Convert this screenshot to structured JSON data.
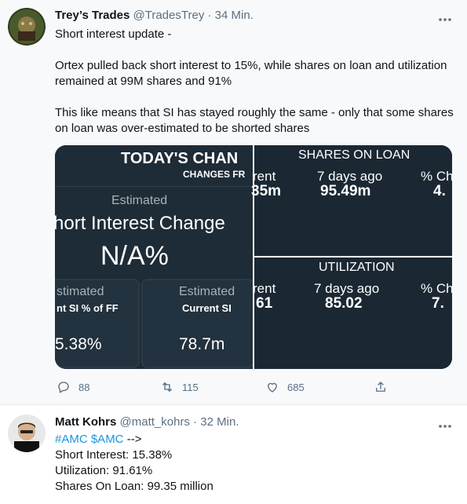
{
  "tweet1": {
    "author_name": "Trey’s Trades",
    "handle": "@TradesTrey",
    "separator": "·",
    "time": "34 Min.",
    "lines": [
      "Short interest update -",
      "",
      "Ortex pulled back short interest to 15%, while shares on loan and utilization remained at 99M shares and 91%",
      "",
      "This like means that SI has stayed roughly the same - only that some shares on loan was over-estimated to be shorted shares"
    ],
    "media": {
      "left": {
        "title": "TODAY'S CHAN",
        "subtitle": "CHANGES FR",
        "estimated_label": "Estimated",
        "metric_label": "hort Interest Change",
        "metric_value": "N/A%",
        "card1_estimated": "stimated",
        "card1_label": "nt SI % of FF",
        "card1_value": "5.38%",
        "card2_estimated": "Estimated",
        "card2_label": "Current SI",
        "card2_value": "78.7m"
      },
      "top_right": {
        "title": "SHARES ON LOAN",
        "col1_label": "rent",
        "col1_value": "35m",
        "col2_label": "7 days ago",
        "col2_value": "95.49m",
        "col3_label": "% Ch",
        "col3_value": "4."
      },
      "bottom_right": {
        "title": "UTILIZATION",
        "col1_label": "rent",
        "col1_value": "61",
        "col2_label": "7 days ago",
        "col2_value": "85.02",
        "col3_label": "% Ch",
        "col3_value": "7."
      }
    },
    "actions": {
      "replies": "88",
      "retweets": "115",
      "likes": "685"
    }
  },
  "tweet2": {
    "author_name": "Matt Kohrs",
    "handle": "@matt_kohrs",
    "separator": "·",
    "time": "32 Min.",
    "tags": "#AMC $AMC",
    "arrow": " -->",
    "line1": "Short Interest: 15.38%",
    "line2": "Utilization: 91.61%",
    "line3": "Shares On Loan: 99.35 million"
  },
  "icons": [
    "more-icon",
    "reply-icon",
    "retweet-icon",
    "like-icon",
    "share-icon"
  ],
  "colors": {
    "muted": "#5b7083",
    "link": "#1b95e0",
    "media_bg": "#1a2127"
  }
}
